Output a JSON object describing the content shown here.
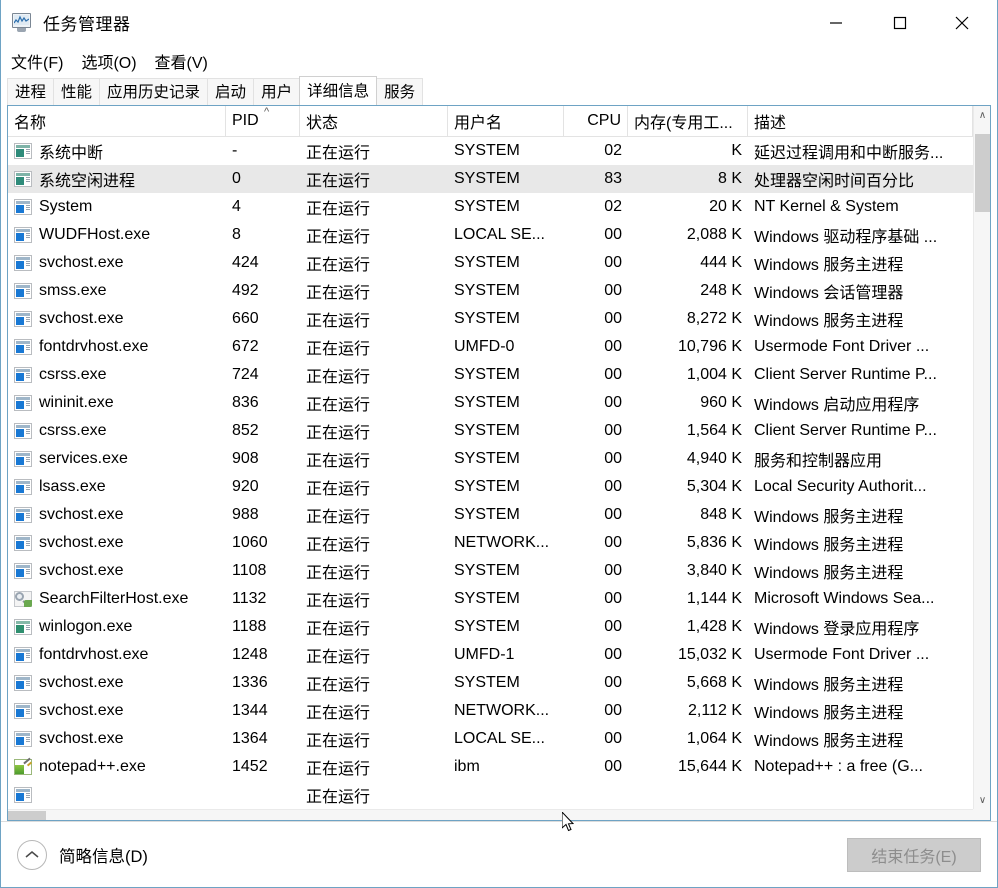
{
  "window": {
    "title": "任务管理器",
    "icon": "task-manager-monitor-icon",
    "controls": {
      "minimize": "–",
      "maximize": "□",
      "close": "✕"
    }
  },
  "menubar": {
    "items": [
      {
        "label": "文件(F)"
      },
      {
        "label": "选项(O)"
      },
      {
        "label": "查看(V)"
      }
    ]
  },
  "tabs": {
    "active": "详细信息",
    "items": [
      {
        "label": "进程"
      },
      {
        "label": "性能"
      },
      {
        "label": "应用历史记录"
      },
      {
        "label": "启动"
      },
      {
        "label": "用户"
      },
      {
        "label": "详细信息"
      },
      {
        "label": "服务"
      }
    ]
  },
  "table": {
    "columns": [
      {
        "key": "name",
        "label": "名称",
        "align": "left"
      },
      {
        "key": "pid",
        "label": "PID",
        "align": "left",
        "sort": "asc"
      },
      {
        "key": "status",
        "label": "状态",
        "align": "left"
      },
      {
        "key": "user",
        "label": "用户名",
        "align": "left"
      },
      {
        "key": "cpu",
        "label": "CPU",
        "align": "right"
      },
      {
        "key": "memory",
        "label": "内存(专用工...",
        "align": "right"
      },
      {
        "key": "desc",
        "label": "描述",
        "align": "left"
      }
    ],
    "sort_indicator": "^",
    "selected_row_index": 1,
    "rows": [
      {
        "icon": "process-icon-system",
        "name": "系统中断",
        "pid": "-",
        "status": "正在运行",
        "user": "SYSTEM",
        "cpu": "02",
        "memory": "K",
        "desc": "延迟过程调用和中断服务..."
      },
      {
        "icon": "process-icon-system",
        "name": "系统空闲进程",
        "pid": "0",
        "status": "正在运行",
        "user": "SYSTEM",
        "cpu": "83",
        "memory": "8 K",
        "desc": "处理器空闲时间百分比"
      },
      {
        "icon": "process-icon-exe",
        "name": "System",
        "pid": "4",
        "status": "正在运行",
        "user": "SYSTEM",
        "cpu": "02",
        "memory": "20 K",
        "desc": "NT Kernel & System"
      },
      {
        "icon": "process-icon-exe",
        "name": "WUDFHost.exe",
        "pid": "8",
        "status": "正在运行",
        "user": "LOCAL SE...",
        "cpu": "00",
        "memory": "2,088 K",
        "desc": "Windows 驱动程序基础 ..."
      },
      {
        "icon": "process-icon-exe",
        "name": "svchost.exe",
        "pid": "424",
        "status": "正在运行",
        "user": "SYSTEM",
        "cpu": "00",
        "memory": "444 K",
        "desc": "Windows 服务主进程"
      },
      {
        "icon": "process-icon-exe",
        "name": "smss.exe",
        "pid": "492",
        "status": "正在运行",
        "user": "SYSTEM",
        "cpu": "00",
        "memory": "248 K",
        "desc": "Windows 会话管理器"
      },
      {
        "icon": "process-icon-exe",
        "name": "svchost.exe",
        "pid": "660",
        "status": "正在运行",
        "user": "SYSTEM",
        "cpu": "00",
        "memory": "8,272 K",
        "desc": "Windows 服务主进程"
      },
      {
        "icon": "process-icon-exe",
        "name": "fontdrvhost.exe",
        "pid": "672",
        "status": "正在运行",
        "user": "UMFD-0",
        "cpu": "00",
        "memory": "10,796 K",
        "desc": "Usermode Font Driver ..."
      },
      {
        "icon": "process-icon-exe",
        "name": "csrss.exe",
        "pid": "724",
        "status": "正在运行",
        "user": "SYSTEM",
        "cpu": "00",
        "memory": "1,004 K",
        "desc": "Client Server Runtime P..."
      },
      {
        "icon": "process-icon-exe",
        "name": "wininit.exe",
        "pid": "836",
        "status": "正在运行",
        "user": "SYSTEM",
        "cpu": "00",
        "memory": "960 K",
        "desc": "Windows 启动应用程序"
      },
      {
        "icon": "process-icon-exe",
        "name": "csrss.exe",
        "pid": "852",
        "status": "正在运行",
        "user": "SYSTEM",
        "cpu": "00",
        "memory": "1,564 K",
        "desc": "Client Server Runtime P..."
      },
      {
        "icon": "process-icon-exe",
        "name": "services.exe",
        "pid": "908",
        "status": "正在运行",
        "user": "SYSTEM",
        "cpu": "00",
        "memory": "4,940 K",
        "desc": "服务和控制器应用"
      },
      {
        "icon": "process-icon-exe",
        "name": "lsass.exe",
        "pid": "920",
        "status": "正在运行",
        "user": "SYSTEM",
        "cpu": "00",
        "memory": "5,304 K",
        "desc": "Local Security Authorit..."
      },
      {
        "icon": "process-icon-exe",
        "name": "svchost.exe",
        "pid": "988",
        "status": "正在运行",
        "user": "SYSTEM",
        "cpu": "00",
        "memory": "848 K",
        "desc": "Windows 服务主进程"
      },
      {
        "icon": "process-icon-exe",
        "name": "svchost.exe",
        "pid": "1060",
        "status": "正在运行",
        "user": "NETWORK...",
        "cpu": "00",
        "memory": "5,836 K",
        "desc": "Windows 服务主进程"
      },
      {
        "icon": "process-icon-exe",
        "name": "svchost.exe",
        "pid": "1108",
        "status": "正在运行",
        "user": "SYSTEM",
        "cpu": "00",
        "memory": "3,840 K",
        "desc": "Windows 服务主进程"
      },
      {
        "icon": "process-icon-search",
        "name": "SearchFilterHost.exe",
        "pid": "1132",
        "status": "正在运行",
        "user": "SYSTEM",
        "cpu": "00",
        "memory": "1,144 K",
        "desc": "Microsoft Windows Sea..."
      },
      {
        "icon": "process-icon-green",
        "name": "winlogon.exe",
        "pid": "1188",
        "status": "正在运行",
        "user": "SYSTEM",
        "cpu": "00",
        "memory": "1,428 K",
        "desc": "Windows 登录应用程序"
      },
      {
        "icon": "process-icon-exe",
        "name": "fontdrvhost.exe",
        "pid": "1248",
        "status": "正在运行",
        "user": "UMFD-1",
        "cpu": "00",
        "memory": "15,032 K",
        "desc": "Usermode Font Driver ..."
      },
      {
        "icon": "process-icon-exe",
        "name": "svchost.exe",
        "pid": "1336",
        "status": "正在运行",
        "user": "SYSTEM",
        "cpu": "00",
        "memory": "5,668 K",
        "desc": "Windows 服务主进程"
      },
      {
        "icon": "process-icon-exe",
        "name": "svchost.exe",
        "pid": "1344",
        "status": "正在运行",
        "user": "NETWORK...",
        "cpu": "00",
        "memory": "2,112 K",
        "desc": "Windows 服务主进程"
      },
      {
        "icon": "process-icon-exe",
        "name": "svchost.exe",
        "pid": "1364",
        "status": "正在运行",
        "user": "LOCAL SE...",
        "cpu": "00",
        "memory": "1,064 K",
        "desc": "Windows 服务主进程"
      },
      {
        "icon": "process-icon-npp",
        "name": "notepad++.exe",
        "pid": "1452",
        "status": "正在运行",
        "user": "ibm",
        "cpu": "00",
        "memory": "15,644 K",
        "desc": "Notepad++ : a free (G..."
      },
      {
        "icon": "process-icon-exe",
        "name": "",
        "pid": "",
        "status": "正在运行",
        "user": "",
        "cpu": "",
        "memory": "",
        "desc": ""
      }
    ]
  },
  "scrollbars": {
    "vertical": {
      "up_arrow": "∧",
      "down_arrow": "∨"
    }
  },
  "statusbar": {
    "fewer_details_label": "简略信息(D)",
    "fewer_details_icon": "chevron-up-circle-icon",
    "end_task_label": "结束任务(E)",
    "end_task_disabled": true
  },
  "colors": {
    "window_border": "#6ea3c4",
    "selected_row": "#e8e8e8",
    "icon_blue": "#1878d4",
    "icon_teal": "#2e8b7a",
    "disabled_button_bg": "#cccccc",
    "scrollbar_thumb": "#cdcdcd"
  }
}
